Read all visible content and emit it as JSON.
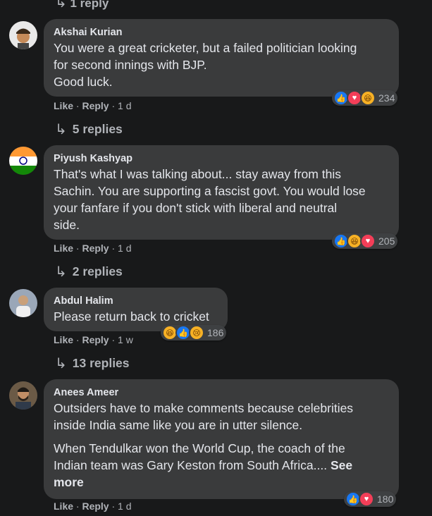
{
  "top_reply": {
    "label": "1 reply"
  },
  "comments": [
    {
      "author": "Akshai Kurian",
      "text": "You were a great cricketer, but a failed politician looking\nfor second innings with BJP.\nGood luck.",
      "like_label": "Like",
      "reply_label": "Reply",
      "time": "1 d",
      "reaction_icons": [
        "like-icon",
        "love-icon",
        "haha-icon"
      ],
      "reaction_count": "234",
      "replies": "5 replies"
    },
    {
      "author": "Piyush Kashyap",
      "text": "That's what I was talking about... stay away from this\nSachin. You are supporting a fascist govt. You would lose\nyour fanfare if you don't stick with liberal and neutral\nside.",
      "like_label": "Like",
      "reply_label": "Reply",
      "time": "1 d",
      "reaction_icons": [
        "like-icon",
        "haha-icon",
        "love-icon"
      ],
      "reaction_count": "205",
      "replies": "2 replies"
    },
    {
      "author": "Abdul Halim",
      "text": "Please return back to cricket",
      "like_label": "Like",
      "reply_label": "Reply",
      "time": "1 w",
      "reaction_icons": [
        "haha-icon",
        "like-icon",
        "sad-icon"
      ],
      "reaction_count": "186",
      "replies": "13 replies"
    },
    {
      "author": "Anees Ameer",
      "text": "Outsiders have to make comments because celebrities\ninside India same like you are in utter silence.",
      "text2": "When Tendulkar won the World Cup, the coach of the\nIndian team was Gary Keston from South Africa....",
      "see_more": "See\nmore",
      "like_label": "Like",
      "reply_label": "Reply",
      "time": "1 d",
      "reaction_icons": [
        "like-icon",
        "love-icon"
      ],
      "reaction_count": "180"
    }
  ],
  "colors": {
    "background": "#18191a",
    "bubble": "#3a3b3c",
    "like": "#1877f2",
    "love": "#f33e58",
    "haha": "#f7b125"
  }
}
